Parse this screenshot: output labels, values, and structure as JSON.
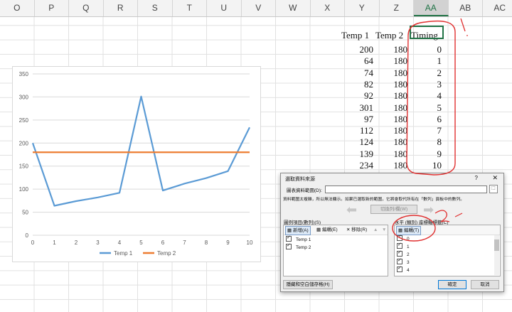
{
  "columns": [
    "O",
    "P",
    "Q",
    "R",
    "S",
    "T",
    "U",
    "V",
    "W",
    "X",
    "Y",
    "Z",
    "AA",
    "AB",
    "AC"
  ],
  "selected_column": "AA",
  "table": {
    "headers": [
      "Temp 1",
      "Temp 2",
      "Timing"
    ],
    "rows": [
      [
        "200",
        "180",
        "0"
      ],
      [
        "64",
        "180",
        "1"
      ],
      [
        "74",
        "180",
        "2"
      ],
      [
        "82",
        "180",
        "3"
      ],
      [
        "92",
        "180",
        "4"
      ],
      [
        "301",
        "180",
        "5"
      ],
      [
        "97",
        "180",
        "6"
      ],
      [
        "112",
        "180",
        "7"
      ],
      [
        "124",
        "180",
        "8"
      ],
      [
        "139",
        "180",
        "9"
      ],
      [
        "234",
        "180",
        "10"
      ]
    ]
  },
  "chart_data": {
    "type": "line",
    "x": [
      0,
      1,
      2,
      3,
      4,
      5,
      6,
      7,
      8,
      9,
      10
    ],
    "series": [
      {
        "name": "Temp 1",
        "values": [
          200,
          64,
          74,
          82,
          92,
          301,
          97,
          112,
          124,
          139,
          234
        ],
        "color": "#5b9bd5"
      },
      {
        "name": "Temp 2",
        "values": [
          180,
          180,
          180,
          180,
          180,
          180,
          180,
          180,
          180,
          180,
          180
        ],
        "color": "#ed7d31"
      }
    ],
    "ylim": [
      0,
      350
    ],
    "yticks": [
      "0",
      "50",
      "100",
      "150",
      "200",
      "250",
      "300",
      "350"
    ],
    "xticks": [
      "0",
      "1",
      "2",
      "3",
      "4",
      "5",
      "6",
      "7",
      "8",
      "9",
      "10"
    ],
    "grid": true,
    "legend": "bottom"
  },
  "dialog": {
    "title": "選取資料來源",
    "help": "?",
    "close": "✕",
    "range_label": "圖表資料範圍(D):",
    "range_note": "資料範圍太複雜，所以無法顯示。如果已選取新的範圍，它將會取代所有在「數列」頁板中的數列。",
    "switch_label": "切換列/欄(W)",
    "series_heading": "圖例項目(數列)(S)",
    "add_label": "新增(A)",
    "edit_label": "編輯(E)",
    "remove_label": "移除(R)",
    "series_items": [
      "Temp 1",
      "Temp 2"
    ],
    "axis_heading": "水平 (類別) 座標軸標籤(C)",
    "axis_edit_label": "編輯(T)",
    "axis_items": [
      "0",
      "1",
      "2",
      "3",
      "4"
    ],
    "hidden_cells_label": "隱藏和空白儲存格(H)",
    "ok_label": "確定",
    "cancel_label": "取消"
  }
}
